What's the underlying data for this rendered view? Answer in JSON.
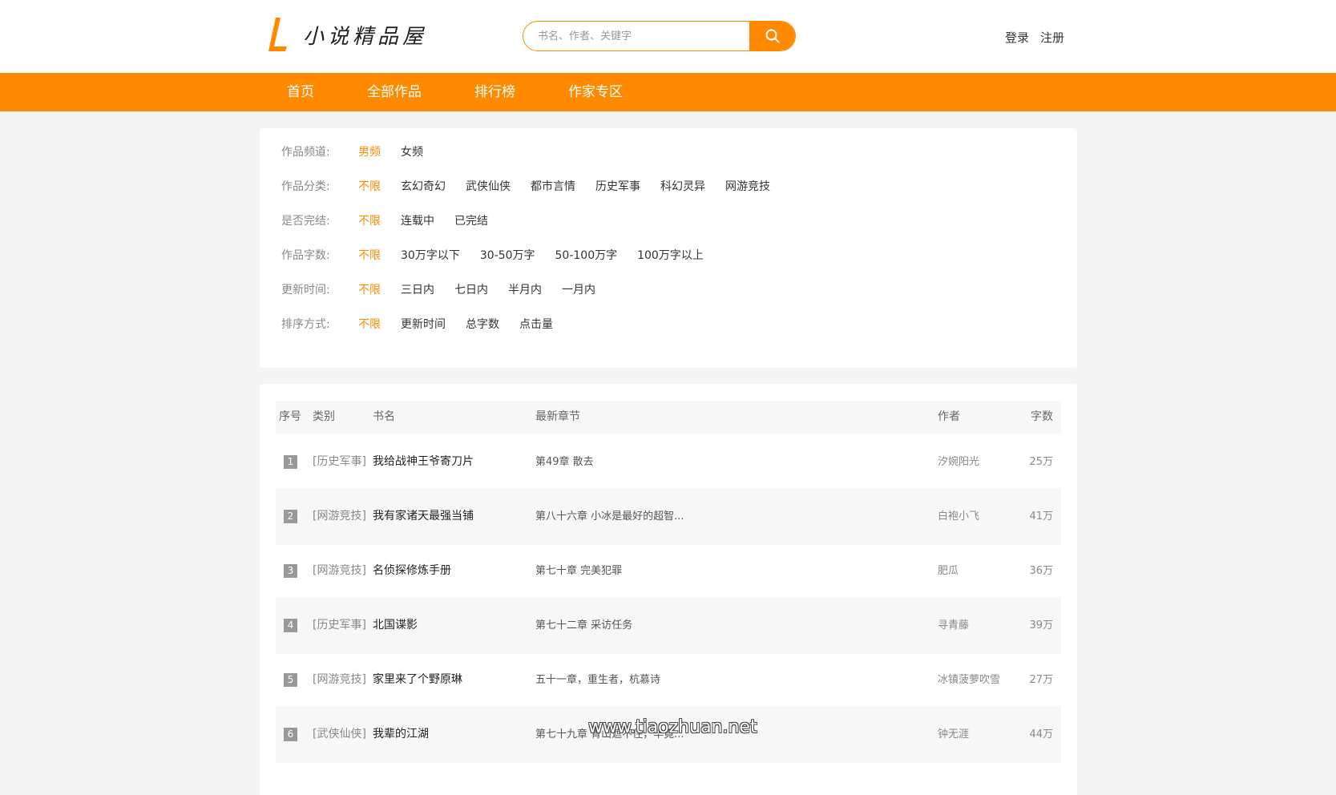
{
  "header": {
    "logo_text": "小说精品屋",
    "search_placeholder": "书名、作者、关键字",
    "login": "登录",
    "register": "注册"
  },
  "nav": [
    "首页",
    "全部作品",
    "排行榜",
    "作家专区"
  ],
  "filters": [
    {
      "label": "作品频道:",
      "options": [
        "男频",
        "女频"
      ],
      "active": 0
    },
    {
      "label": "作品分类:",
      "options": [
        "不限",
        "玄幻奇幻",
        "武侠仙侠",
        "都市言情",
        "历史军事",
        "科幻灵异",
        "网游竞技"
      ],
      "active": 0
    },
    {
      "label": "是否完结:",
      "options": [
        "不限",
        "连载中",
        "已完结"
      ],
      "active": 0
    },
    {
      "label": "作品字数:",
      "options": [
        "不限",
        "30万字以下",
        "30-50万字",
        "50-100万字",
        "100万字以上"
      ],
      "active": 0
    },
    {
      "label": "更新时间:",
      "options": [
        "不限",
        "三日内",
        "七日内",
        "半月内",
        "一月内"
      ],
      "active": 0
    },
    {
      "label": "排序方式:",
      "options": [
        "不限",
        "更新时间",
        "总字数",
        "点击量"
      ],
      "active": 0
    }
  ],
  "table": {
    "headers": {
      "no": "序号",
      "category": "类别",
      "name": "书名",
      "chapter": "最新章节",
      "author": "作者",
      "words": "字数"
    },
    "rows": [
      {
        "rank": "1",
        "category": "[历史军事]",
        "name": "我给战神王爷寄刀片",
        "chapter": "第49章 散去",
        "author": "汐婉阳光",
        "words": "25万"
      },
      {
        "rank": "2",
        "category": "[网游竞技]",
        "name": "我有家诸天最强当铺",
        "chapter": "第八十六章 小冰是最好的超智...",
        "author": "白袍小飞",
        "words": "41万"
      },
      {
        "rank": "3",
        "category": "[网游竞技]",
        "name": "名侦探修炼手册",
        "chapter": "第七十章 完美犯罪",
        "author": "肥瓜",
        "words": "36万"
      },
      {
        "rank": "4",
        "category": "[历史军事]",
        "name": "北国谍影",
        "chapter": "第七十二章 采访任务",
        "author": "寻青藤",
        "words": "39万"
      },
      {
        "rank": "5",
        "category": "[网游竞技]",
        "name": "家里来了个野原琳",
        "chapter": "五十一章，重生者，杭慕诗",
        "author": "冰镇菠萝吹雪",
        "words": "27万"
      },
      {
        "rank": "6",
        "category": "[武侠仙侠]",
        "name": "我辈的江湖",
        "chapter": "第七十九章 青山遮不住，毕竟...",
        "author": "钟无涯",
        "words": "44万"
      }
    ]
  },
  "watermark": "www.tiaozhuan.net",
  "colors": {
    "accent": "#ff8a00",
    "rank_badge": "#999999"
  }
}
